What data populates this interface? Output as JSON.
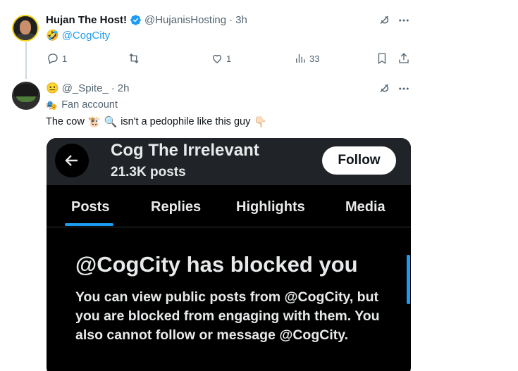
{
  "tweet1": {
    "display_name": "Hujan The Host!",
    "handle": "@HujanisHosting",
    "separator": "·",
    "time": "3h",
    "emoji": "🤣",
    "mention": "@CogCity",
    "reply_count": "1",
    "retweet_count": "",
    "like_count": "1",
    "view_count": "33"
  },
  "tweet2": {
    "emoji_face": "😐",
    "handle": "@_Spite_",
    "separator": "·",
    "time": "2h",
    "tag_emoji": "🎭",
    "tag_label": "Fan account",
    "text_part1": "The cow",
    "emoji_cow": "🐮",
    "emoji_magnifier": "🔍",
    "text_part2": "isn't a pedophile like this guy",
    "emoji_point": "👇🏻"
  },
  "embed": {
    "title": "Cog The Irrelevant",
    "posts_count": "21.3K posts",
    "follow_label": "Follow",
    "tabs": [
      "Posts",
      "Replies",
      "Highlights",
      "Media"
    ],
    "blocked_title": "@CogCity has blocked you",
    "blocked_body": "You can view public posts from @CogCity, but you are blocked from engaging with them. You also cannot follow or message @CogCity."
  },
  "colors": {
    "accent": "#1d9bf0",
    "muted": "#536471",
    "text": "#0f1419",
    "embed_bg": "#000000"
  }
}
